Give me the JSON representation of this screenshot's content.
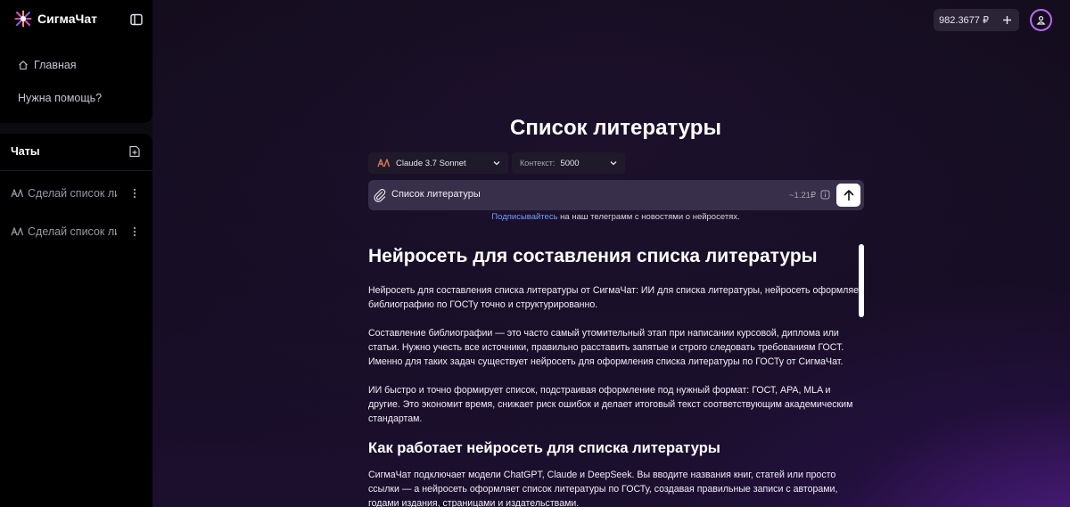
{
  "brand": {
    "name": "СигмаЧат"
  },
  "sidebar": {
    "nav": [
      {
        "label": "Главная",
        "icon": "home-icon"
      },
      {
        "label": "Нужна помощь?"
      }
    ],
    "chats_title": "Чаты",
    "chats": [
      {
        "title": "Сделай список литературы"
      },
      {
        "title": "Сделай список литературы"
      }
    ]
  },
  "header": {
    "balance": "982.3677 ₽"
  },
  "main": {
    "title": "Список литературы",
    "model": {
      "name": "Claude 3.7 Sonnet"
    },
    "context": {
      "label": "Контекст:",
      "value": "5000"
    },
    "input": {
      "value": "Список литературы",
      "cost": "~1.21₽"
    },
    "telegram": {
      "link": "Подписывайтесь",
      "rest": " на наш телеграмм с новостями о нейросетях."
    },
    "article": {
      "h1": "Нейросеть для составления списка литературы",
      "p1": "Нейросеть для составления списка литературы от СигмаЧат: ИИ для списка литературы, нейросеть оформляет библиографию по ГОСТу точно и структурированно.",
      "p2": "Составление библиографии — это часто самый утомительный этап при написании курсовой, диплома или статьи. Нужно учесть все источники, правильно расставить запятые и строго следовать требованиям ГОСТ. Именно для таких задач существует нейросеть для оформления списка литературы по ГОСТу от СигмаЧат.",
      "p3": "ИИ быстро и точно формирует список, подстраивая оформление под нужный формат: ГОСТ, APA, MLA и другие. Это экономит время, снижает риск ошибок и делает итоговый текст соответствующим академическим стандартам.",
      "h2": "Как работает нейросеть для списка литературы",
      "p4": "СигмаЧат подключает модели ChatGPT, Claude и DeepSeek. Вы вводите названия книг, статей или просто ссылки — а нейросеть оформляет список литературы по ГОСТу, создавая правильные записи с авторами, годами издания, страницами и издательствами."
    }
  },
  "colors": {
    "accent": "#b86af0",
    "link": "#6f9dff",
    "claude_orange": "#d97757"
  }
}
